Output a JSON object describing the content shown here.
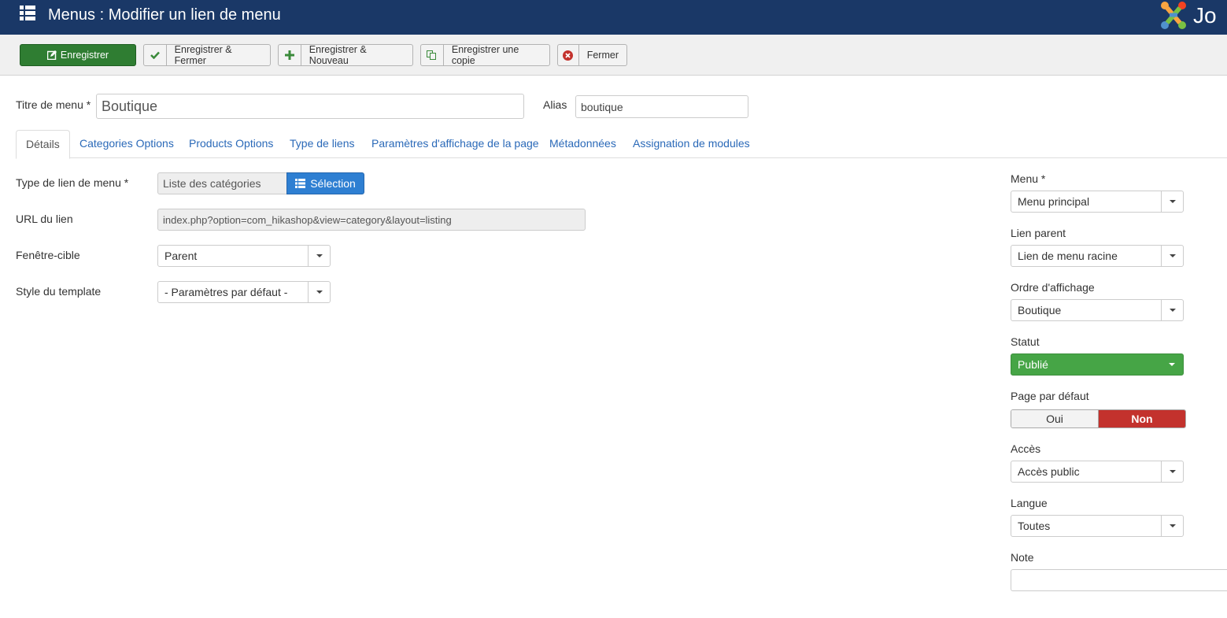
{
  "header": {
    "title": "Menus : Modifier un lien de menu",
    "logo_text": "Jo"
  },
  "toolbar": {
    "save": "Enregistrer",
    "save_close": "Enregistrer & Fermer",
    "save_new": "Enregistrer & Nouveau",
    "save_copy": "Enregistrer une copie",
    "close": "Fermer"
  },
  "form": {
    "title_label": "Titre de menu *",
    "title_value": "Boutique",
    "alias_label": "Alias",
    "alias_value": "boutique"
  },
  "tabs": [
    "Détails",
    "Categories Options",
    "Products Options",
    "Type de liens",
    "Paramètres d'affichage de la page",
    "Métadonnées",
    "Assignation de modules"
  ],
  "details": {
    "link_type_label": "Type de lien de menu *",
    "link_type_value": "Liste des catégories",
    "selection_button": "Sélection",
    "url_label": "URL du lien",
    "url_value": "index.php?option=com_hikashop&view=category&layout=listing",
    "target_label": "Fenêtre-cible",
    "target_value": "Parent",
    "template_label": "Style du template",
    "template_value": "- Paramètres par défaut -"
  },
  "sidebar": {
    "menu_label": "Menu *",
    "menu_value": "Menu principal",
    "parent_label": "Lien parent",
    "parent_value": "Lien de menu racine",
    "order_label": "Ordre d'affichage",
    "order_value": "Boutique",
    "status_label": "Statut",
    "status_value": "Publié",
    "default_label": "Page par défaut",
    "default_yes": "Oui",
    "default_no": "Non",
    "access_label": "Accès",
    "access_value": "Accès public",
    "language_label": "Langue",
    "language_value": "Toutes",
    "note_label": "Note",
    "note_value": ""
  }
}
